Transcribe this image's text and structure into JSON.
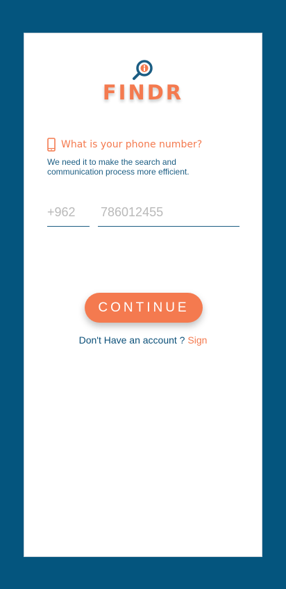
{
  "app": {
    "name": "FINDR"
  },
  "phone_prompt": {
    "question": "What is your phone number?",
    "help": "We need it to make the search and communication process more efficient."
  },
  "inputs": {
    "country_code_placeholder": "+962",
    "phone_placeholder": "786012455"
  },
  "actions": {
    "continue_label": "CONTINUE",
    "account_prompt": "Don't Have an account ?",
    "sign_link": "Sign"
  },
  "colors": {
    "frame": "#04557e",
    "accent": "#f47a4f",
    "text_blue": "#1b5d83"
  },
  "icons": {
    "logo": "search-magnifier-icon",
    "phone": "mobile-phone-icon"
  }
}
